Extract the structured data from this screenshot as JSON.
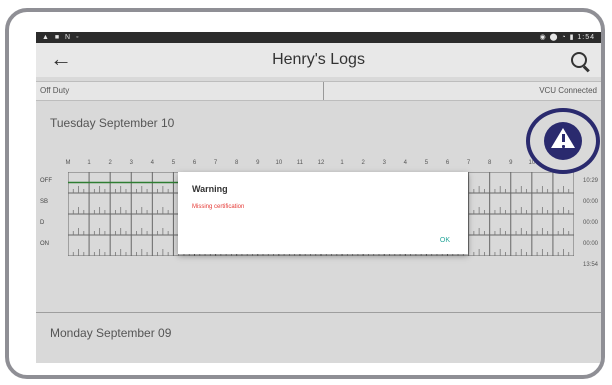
{
  "statusbar": {
    "left_icons": "▲ ■ N ◦",
    "right_text": "◉ ⬤ ◔ ▮ 1:54"
  },
  "appbar": {
    "title": "Henry's Logs",
    "back_icon": "arrow-left-icon",
    "search_icon": "search-icon"
  },
  "status": {
    "duty": "Off Duty",
    "vcu": "VCU Connected"
  },
  "days": [
    {
      "label": "Tuesday September 10"
    },
    {
      "label": "Monday September 09"
    }
  ],
  "grid": {
    "hours": [
      "M",
      "1",
      "2",
      "3",
      "4",
      "5",
      "6",
      "7",
      "8",
      "9",
      "10",
      "11",
      "12",
      "1",
      "2",
      "3",
      "4",
      "5",
      "6",
      "7",
      "8",
      "9",
      "10",
      "11"
    ],
    "rows": [
      "OFF",
      "SB",
      "D",
      "ON"
    ],
    "totals": [
      "10:29",
      "00:00",
      "00:00",
      "00:00",
      "13:54"
    ]
  },
  "dialog": {
    "title": "Warning",
    "message": "Missing certification",
    "ok": "OK"
  },
  "colors": {
    "dialog_message": "#e53935",
    "ok_button": "#26a69a",
    "callout": "#2a2a6e",
    "off_duty_line": "#2e7d32"
  }
}
